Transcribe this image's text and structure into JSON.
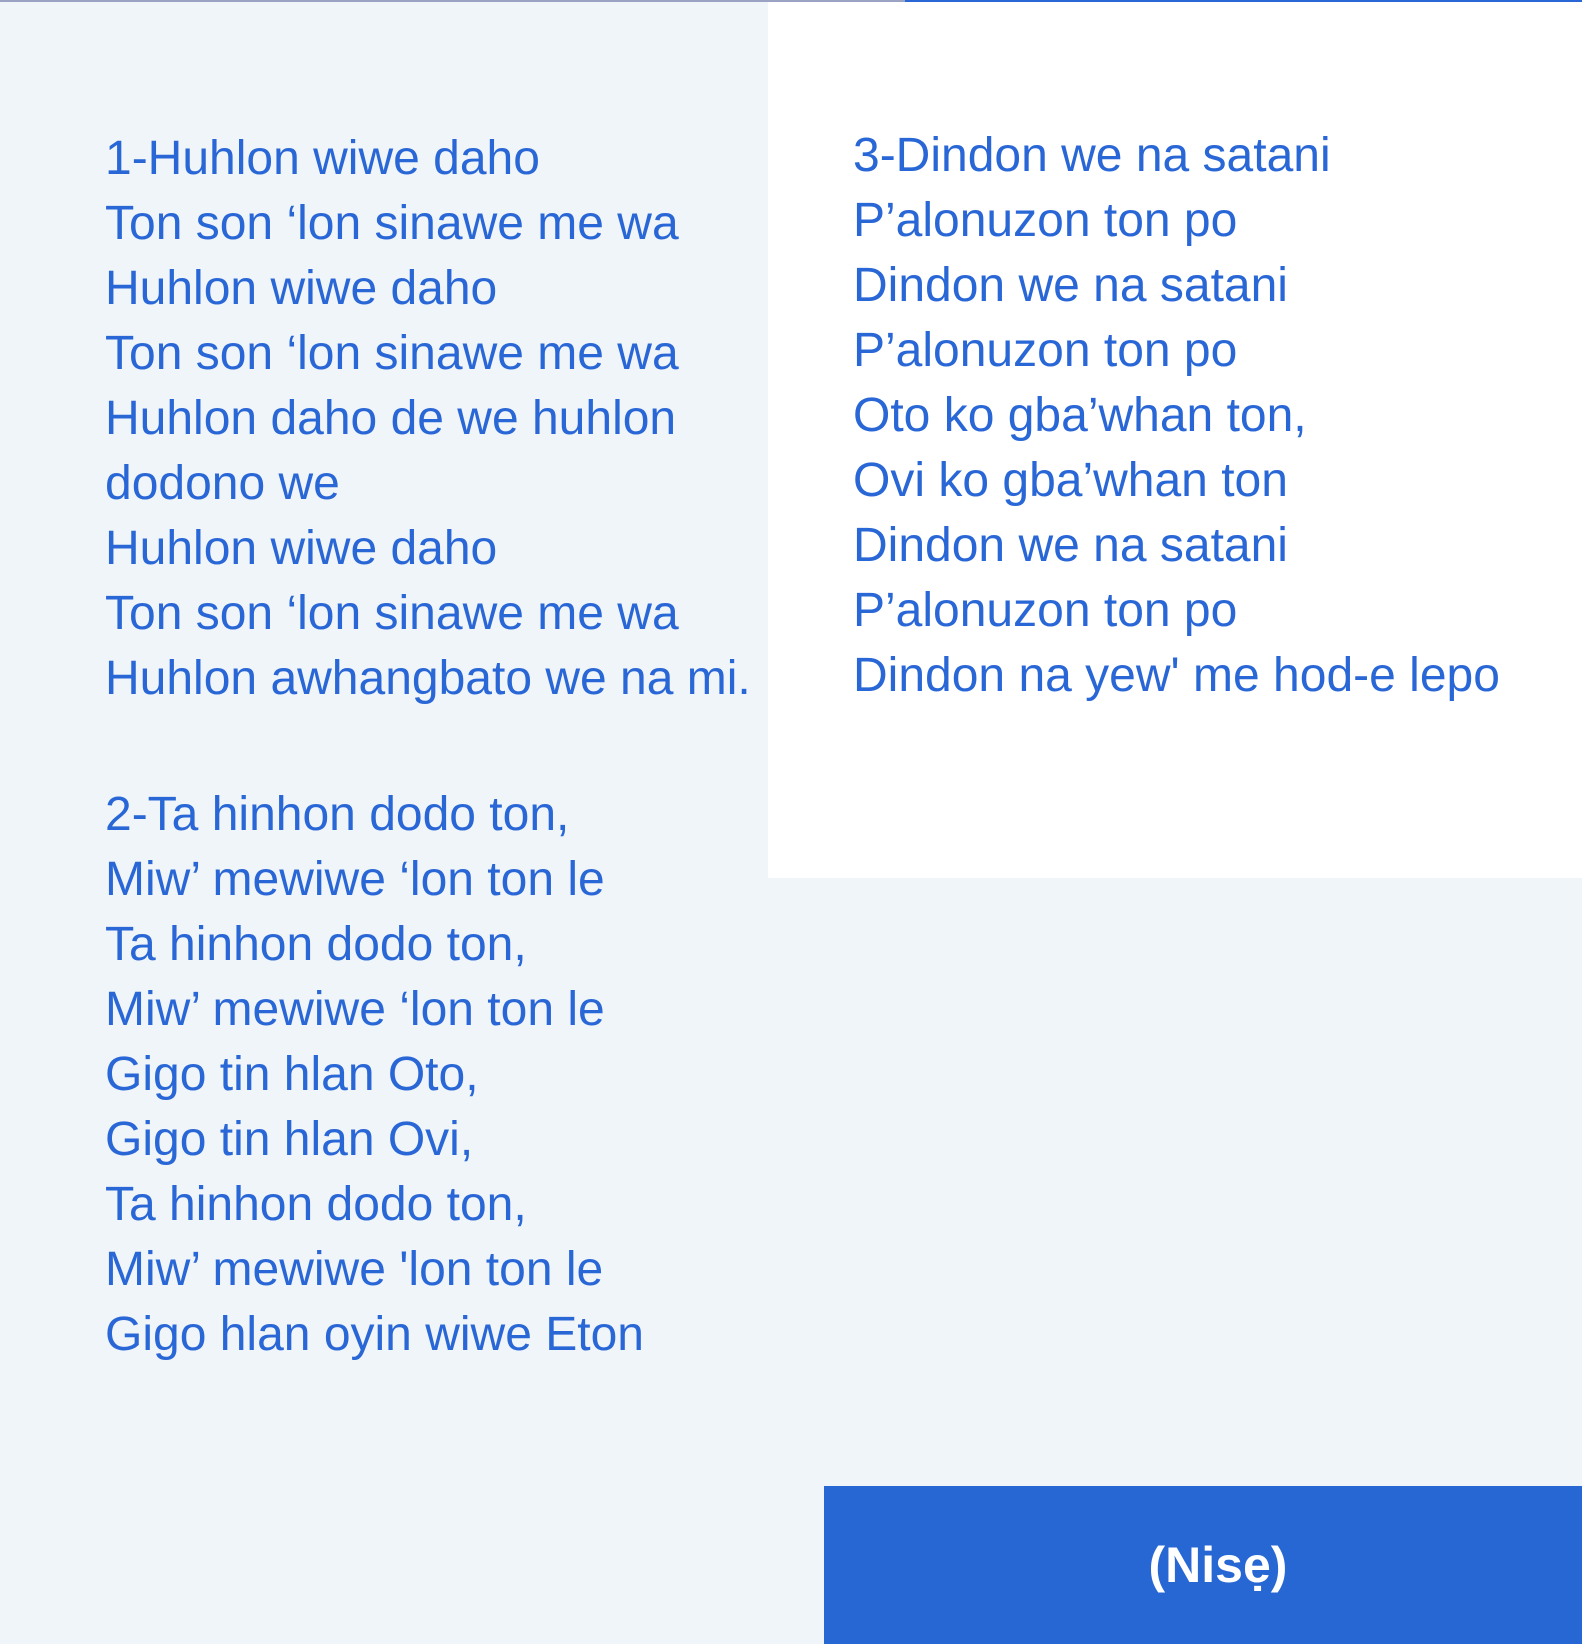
{
  "verses": [
    {
      "lines": [
        "1-Huhlon wiwe daho",
        "Ton son ‘lon sinawe me wa",
        "Huhlon wiwe daho",
        "Ton son ‘lon sinawe me wa",
        "Huhlon daho de we huhlon",
        "dodono we",
        "Huhlon wiwe daho",
        "Ton son ‘lon sinawe me wa",
        "Huhlon awhangbato we na mi."
      ]
    },
    {
      "lines": [
        "2-Ta hinhon dodo ton,",
        "Miw’ mewiwe ‘lon ton le",
        "Ta hinhon dodo ton,",
        "Miw’ mewiwe ‘lon ton le",
        "Gigo tin hlan Oto,",
        "Gigo tin hlan Ovi,",
        "Ta hinhon dodo ton,",
        "Miw’ mewiwe 'lon ton le",
        "Gigo hlan oyin wiwe Eton"
      ]
    },
    {
      "lines": [
        "3-Dindon we na satani",
        "P’alonuzon ton po",
        "Dindon we na satani",
        "P’alonuzon ton po",
        "Oto ko gba’whan ton,",
        "Ovi ko gba’whan ton",
        "Dindon we na satani",
        "P’alonuzon ton po",
        "Dindon na yew' me hod-e lepo"
      ]
    }
  ],
  "signature": "(Nisẹ)",
  "colors": {
    "text": "#2a67d6",
    "background": "#f0f5f9",
    "panel": "#ffffff",
    "box": "#2767d4"
  }
}
